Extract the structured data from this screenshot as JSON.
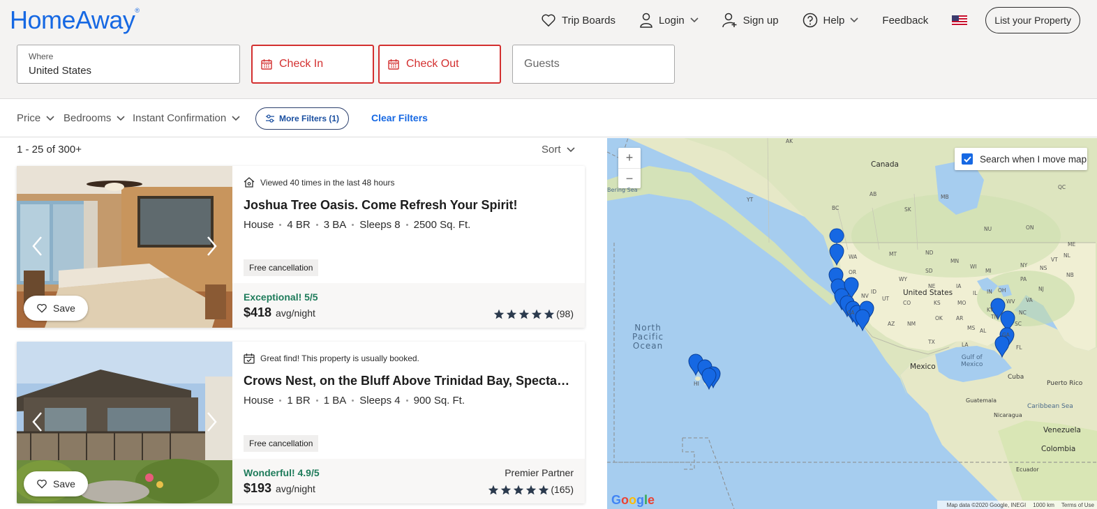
{
  "header": {
    "logo": "HomeAway",
    "logo_mark": "®",
    "nav": {
      "trip_boards": "Trip Boards",
      "login": "Login",
      "sign_up": "Sign up",
      "help": "Help",
      "feedback": "Feedback",
      "list_property": "List your Property"
    }
  },
  "search": {
    "where_label": "Where",
    "where_value": "United States",
    "check_in": "Check In",
    "check_out": "Check Out",
    "guests": "Guests"
  },
  "filters": {
    "price": "Price",
    "bedrooms": "Bedrooms",
    "instant": "Instant Confirmation",
    "more": "More Filters (1)",
    "clear": "Clear Filters"
  },
  "results": {
    "count": "1 - 25 of 300+",
    "sort": "Sort"
  },
  "listings": [
    {
      "badge": "Viewed 40 times in the last 48 hours",
      "title": "Joshua Tree Oasis. Come Refresh Your Spirit!",
      "type": "House",
      "br": "4 BR",
      "ba": "3 BA",
      "sleeps": "Sleeps 8",
      "sqft": "2500 Sq. Ft.",
      "cancel": "Free cancellation",
      "rating": "Exceptional! 5/5",
      "price": "$418",
      "per": "avg/night",
      "stars": 5,
      "reviews": "(98)",
      "partner": "",
      "save": "Save"
    },
    {
      "badge": "Great find! This property is usually booked.",
      "title": "Crows Nest, on the Bluff Above Trinidad Bay, Spectacular Ocean Views",
      "type": "House",
      "br": "1 BR",
      "ba": "1 BA",
      "sleeps": "Sleeps 4",
      "sqft": "900 Sq. Ft.",
      "cancel": "Free cancellation",
      "rating": "Wonderful! 4.9/5",
      "price": "$193",
      "per": "avg/night",
      "stars": 5,
      "reviews": "(165)",
      "partner": "Premier Partner",
      "save": "Save"
    }
  ],
  "map": {
    "search_move": "Search when I move map",
    "search_move_checked": true,
    "zoom_in": "+",
    "zoom_out": "−",
    "labels": {
      "canada": "Canada",
      "united_states": "United States",
      "mexico": "Mexico",
      "north_pacific_1": "North",
      "north_pacific_2": "Pacific",
      "north_pacific_3": "Ocean",
      "gulf_1": "Gulf of",
      "gulf_2": "Mexico",
      "cuba": "Cuba",
      "puerto_rico": "Puerto Rico",
      "guatemala": "Guatemala",
      "nicaragua": "Nicaragua",
      "caribbean": "Caribbean Sea",
      "venezuela": "Venezuela",
      "colombia": "Colombia",
      "ecuador": "Ecuador",
      "bering": "Bering Sea",
      "hi": "HI"
    },
    "states": [
      "AK",
      "YT",
      "BC",
      "AB",
      "SK",
      "MB",
      "NU",
      "ON",
      "QC",
      "NL",
      "NB",
      "NS",
      "WA",
      "OR",
      "ID",
      "MT",
      "ND",
      "MN",
      "WI",
      "MI",
      "NY",
      "VT",
      "ME",
      "SD",
      "WY",
      "NE",
      "IA",
      "IL",
      "IN",
      "OH",
      "PA",
      "NJ",
      "NV",
      "UT",
      "CO",
      "KS",
      "MO",
      "KY",
      "WV",
      "VA",
      "CA",
      "AZ",
      "NM",
      "OK",
      "AR",
      "TN",
      "NC",
      "SC",
      "MS",
      "AL",
      "GA",
      "TX",
      "LA",
      "FL"
    ],
    "google": "Google",
    "attribution": "Map data ©2020 Google, INEGI",
    "scale": "1000 km",
    "terms": "Terms of Use"
  }
}
